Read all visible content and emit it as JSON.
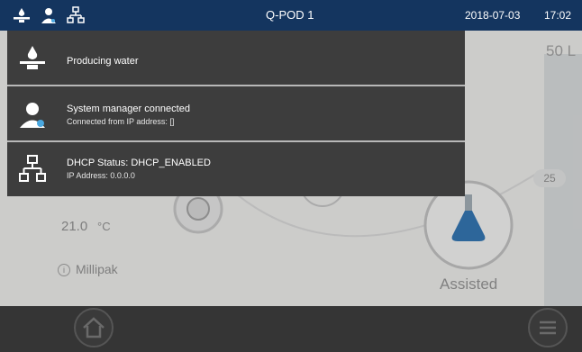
{
  "header": {
    "device_name": "Q-POD 1",
    "date": "2018-07-03",
    "time": "17:02",
    "status_icons": [
      "water-dispense-icon",
      "user-icon",
      "network-icon"
    ]
  },
  "notifications": [
    {
      "icon": "water-dispense-icon",
      "title": "Producing water",
      "subtitle": ""
    },
    {
      "icon": "user-icon",
      "title": "System manager connected",
      "subtitle": "Connected from IP address: []"
    },
    {
      "icon": "network-icon",
      "title": "DHCP Status: DHCP_ENABLED",
      "subtitle": "IP Address: 0.0.0.0"
    }
  ],
  "background": {
    "temperature_value": "21.0",
    "temperature_unit": "°C",
    "filter_label": "Millipak",
    "mode_label": "Assisted",
    "volume_label": "50 L",
    "badge_value": "25"
  },
  "nav": {
    "buttons": [
      "home-icon",
      "menu-icon"
    ]
  },
  "colors": {
    "header_bg": "#14355f",
    "dropdown_bg": "#3d3d3d",
    "accent": "#4aa8e0",
    "flask": "#2e6faa"
  }
}
